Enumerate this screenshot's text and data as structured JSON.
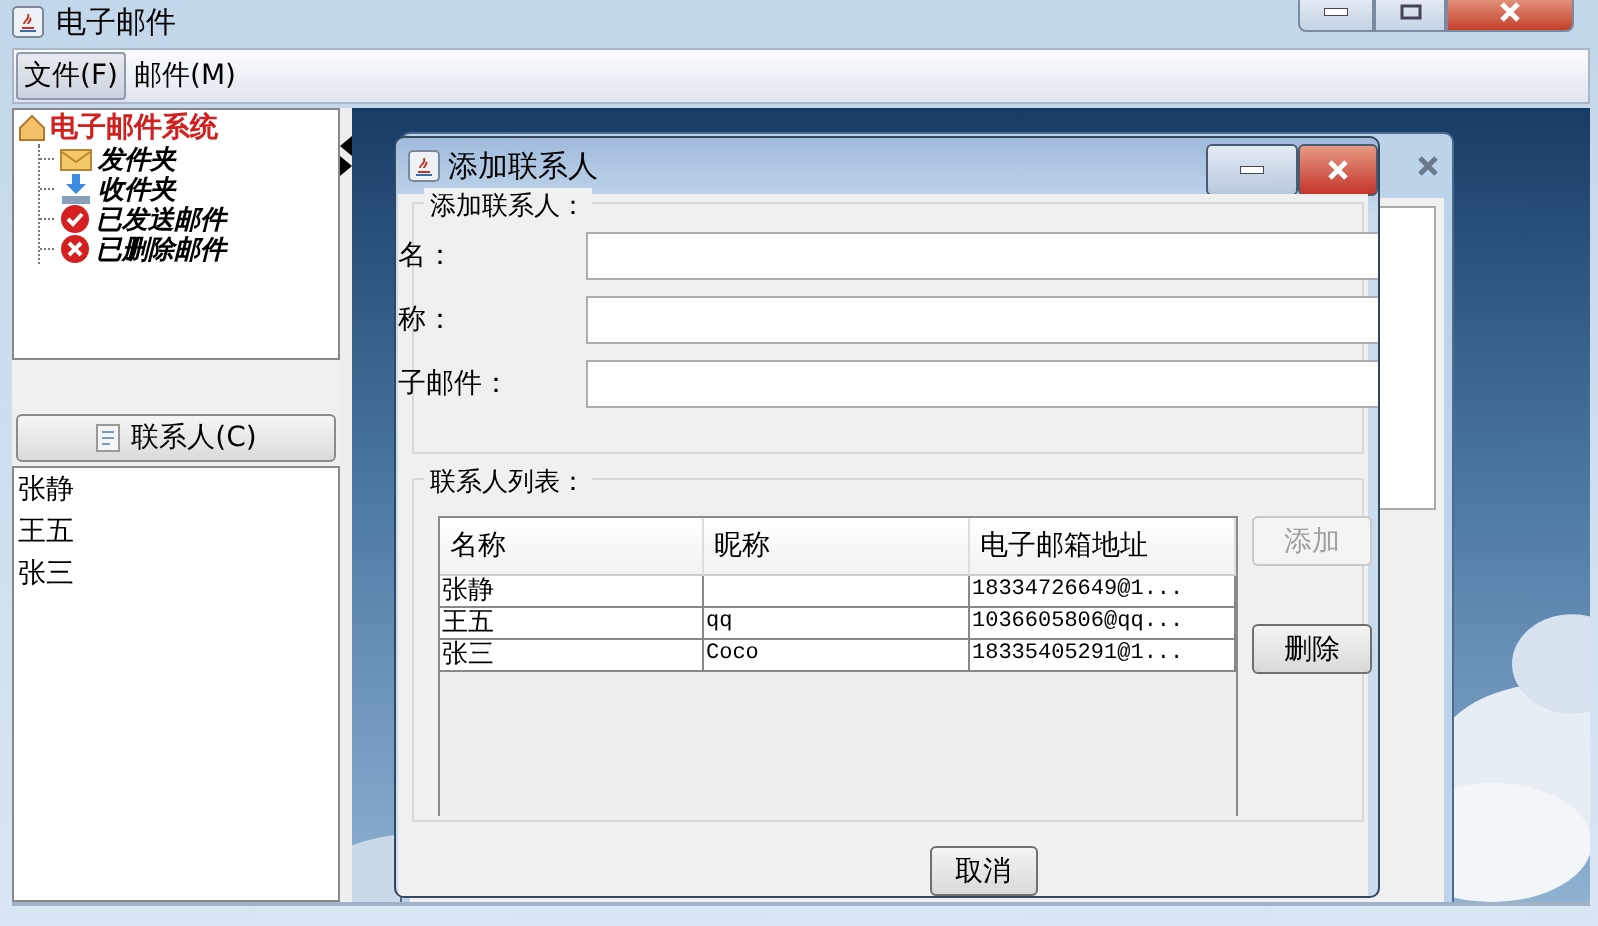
{
  "window": {
    "title": "电子邮件"
  },
  "menu": [
    {
      "label": "文件(F)",
      "selected": true
    },
    {
      "label": "邮件(M)",
      "selected": false
    }
  ],
  "tree": {
    "label": "电子邮件系统",
    "children": [
      {
        "label": "发件夹",
        "kind": "outbox"
      },
      {
        "label": "收件夹",
        "kind": "inbox"
      },
      {
        "label": "已发送邮件",
        "kind": "sent"
      },
      {
        "label": "已删除邮件",
        "kind": "trash"
      }
    ]
  },
  "contacts_button": "联系人(C)",
  "contacts": [
    "张静",
    "王五",
    "张三"
  ],
  "dialog": {
    "title": "添加联系人",
    "form_legend": "添加联系人：",
    "fields": [
      {
        "label": "名："
      },
      {
        "label": "称："
      },
      {
        "label": "子邮件："
      }
    ],
    "list_legend": "联系人列表：",
    "table": {
      "columns": [
        "名称",
        "昵称",
        "电子邮箱地址"
      ],
      "rows": [
        [
          "张静",
          "",
          "18334726649@1..."
        ],
        [
          "王五",
          "qq",
          "1036605806@qq..."
        ],
        [
          "张三",
          "Coco",
          "18335405291@1..."
        ]
      ]
    },
    "buttons": [
      {
        "label": "添加",
        "disabled": true
      },
      {
        "label": "删除",
        "disabled": false
      }
    ],
    "cancel": "取消"
  }
}
